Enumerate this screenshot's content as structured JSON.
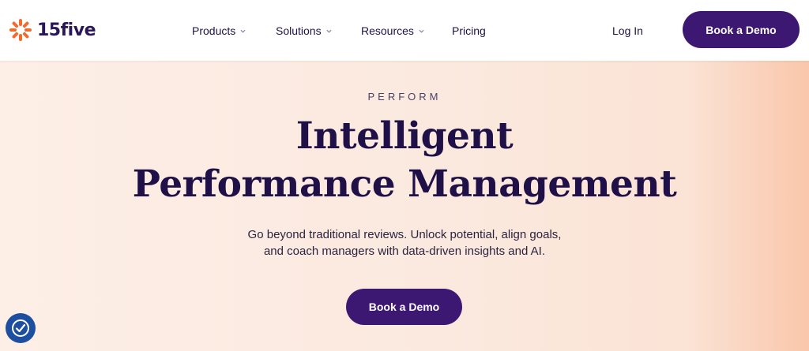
{
  "header": {
    "logo_text": "15five",
    "nav": [
      {
        "label": "Products",
        "has_dropdown": true
      },
      {
        "label": "Solutions",
        "has_dropdown": true
      },
      {
        "label": "Resources",
        "has_dropdown": true
      },
      {
        "label": "Pricing",
        "has_dropdown": false
      }
    ],
    "login_label": "Log In",
    "cta_label": "Book a Demo"
  },
  "hero": {
    "eyebrow": "PERFORM",
    "headline_line1": "Intelligent",
    "headline_line2": "Performance Management",
    "subtext_line1": "Go beyond traditional reviews. Unlock potential, align goals,",
    "subtext_line2": "and coach managers with data-driven insights and AI.",
    "cta_label": "Book a Demo"
  },
  "icons": {
    "logo": "starburst-logo-icon",
    "dropdown": "chevron-down-icon",
    "accessibility": "accessibility-icon"
  },
  "colors": {
    "brand_purple": "#3c1873",
    "text_dark": "#1f1147",
    "logo_orange": "#f26a2e",
    "hero_bg": "#fbe9df",
    "a11y_blue": "#1c4fa0"
  }
}
